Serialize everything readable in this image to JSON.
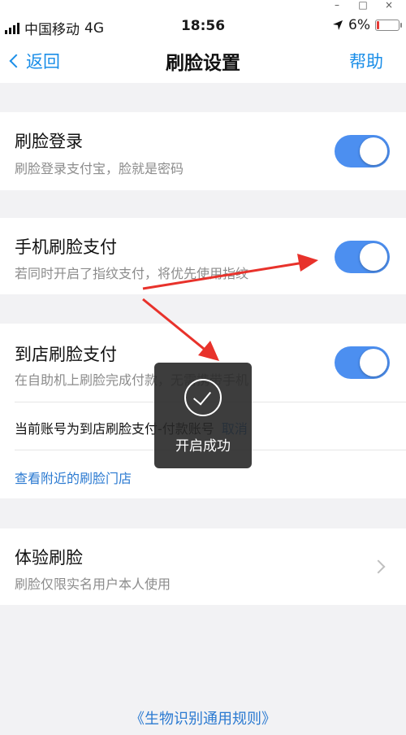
{
  "status_bar": {
    "carrier": "中国移动",
    "network": "4G",
    "time": "18:56",
    "battery": "6%"
  },
  "nav": {
    "back_label": "返回",
    "title": "刷脸设置",
    "help_label": "帮助"
  },
  "face_login": {
    "title": "刷脸登录",
    "subtitle": "刷脸登录支付宝，脸就是密码",
    "enabled": true
  },
  "phone_face_pay": {
    "title": "手机刷脸支付",
    "subtitle": "若同时开启了指纹支付，将优先使用指纹",
    "enabled": true
  },
  "store_face_pay": {
    "title": "到店刷脸支付",
    "subtitle": "在自助机上刷脸完成付款，无需携带手机",
    "enabled": true,
    "account_text": "当前账号为到店刷脸支付-付款账号",
    "cancel_label": "取消",
    "nearby_stores_label": "查看附近的刷脸门店"
  },
  "try_face": {
    "title": "体验刷脸",
    "subtitle": "刷脸仅限实名用户本人使用"
  },
  "toast": {
    "message": "开启成功"
  },
  "footer": {
    "rules_link": "《生物识别通用规则》"
  },
  "colors": {
    "accent": "#1a8ee8",
    "toggle_on": "#4c8ff0",
    "annotation_arrow": "#e8322b"
  }
}
